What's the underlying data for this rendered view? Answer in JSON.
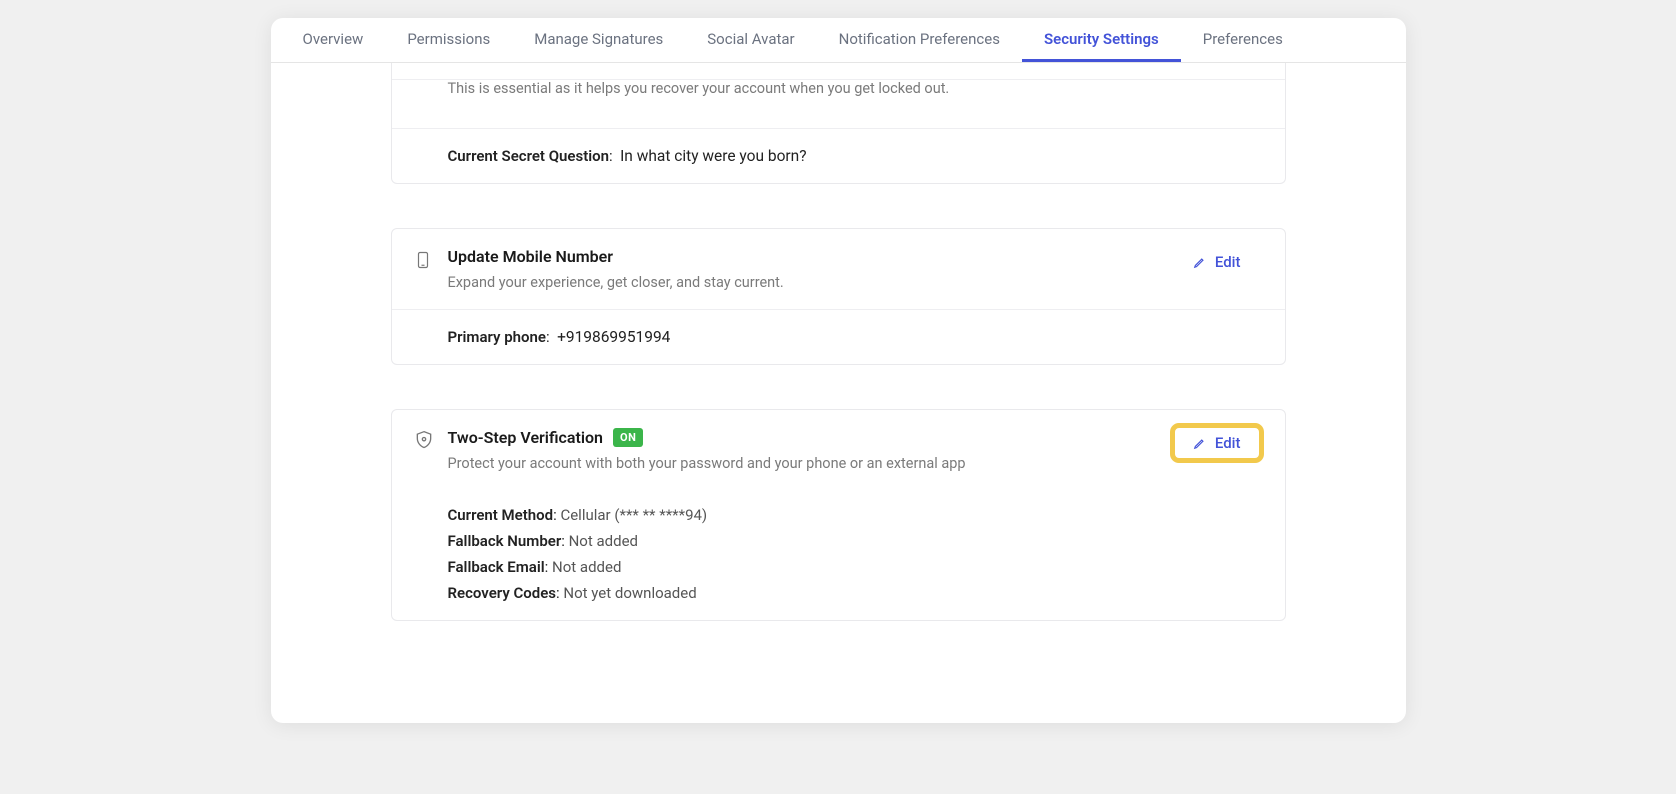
{
  "tabs": [
    {
      "label": "Overview",
      "active": false
    },
    {
      "label": "Permissions",
      "active": false
    },
    {
      "label": "Manage Signatures",
      "active": false
    },
    {
      "label": "Social Avatar",
      "active": false
    },
    {
      "label": "Notification Preferences",
      "active": false
    },
    {
      "label": "Security Settings",
      "active": true
    },
    {
      "label": "Preferences",
      "active": false
    }
  ],
  "edit_label": "Edit",
  "secret_question": {
    "description": "This is essential as it helps you recover your account when you get locked out.",
    "current_label": "Current Secret Question",
    "current_value": "In what city were you born?"
  },
  "mobile": {
    "title": "Update Mobile Number",
    "description": "Expand your experience, get closer, and stay current.",
    "primary_label": "Primary phone",
    "primary_value": "+919869951994"
  },
  "two_step": {
    "title": "Two-Step Verification",
    "badge": "ON",
    "description": "Protect your account with both your password and your phone or an external app",
    "rows": [
      {
        "label": "Current Method",
        "value": "Cellular (*** ** ****94)"
      },
      {
        "label": "Fallback Number",
        "value": "Not added"
      },
      {
        "label": "Fallback Email",
        "value": "Not added"
      },
      {
        "label": "Recovery Codes",
        "value": "Not yet downloaded"
      }
    ]
  }
}
